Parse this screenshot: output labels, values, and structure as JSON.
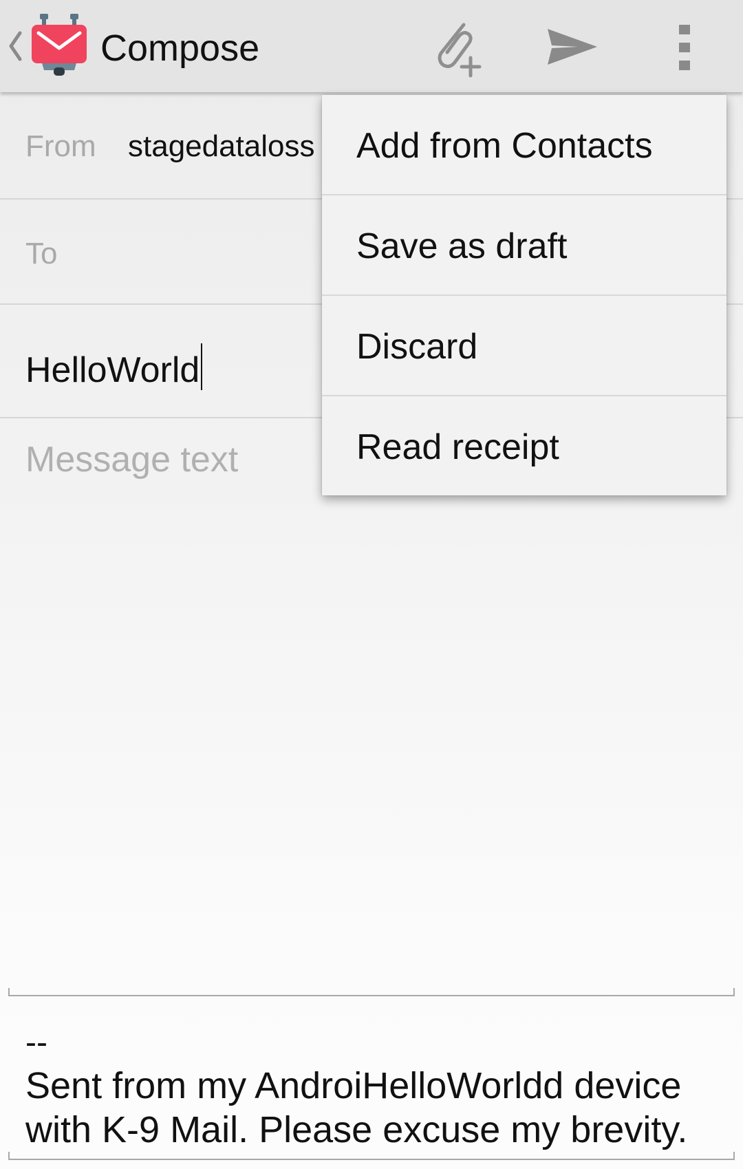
{
  "action_bar": {
    "title": "Compose",
    "background_color": "#e4e4e4",
    "icons": {
      "back": "chevron-left-icon",
      "app": "k9-mail-icon",
      "attach": "attachment-add-icon",
      "send": "send-icon",
      "overflow": "overflow-menu-icon"
    },
    "app_icon_color": "#f0435d"
  },
  "form": {
    "from_label": "From",
    "from_value": "stagedataloss",
    "to_label": "To",
    "to_value": "",
    "subject_value": "HelloWorld",
    "message_placeholder": "Message text"
  },
  "signature": {
    "separator": "--",
    "text": "Sent from my AndroiHelloWorldd device with K-9 Mail. Please excuse my brevity."
  },
  "overflow_menu": {
    "items": [
      {
        "label": "Add from Contacts"
      },
      {
        "label": "Save as draft"
      },
      {
        "label": "Discard"
      },
      {
        "label": "Read receipt"
      }
    ]
  }
}
